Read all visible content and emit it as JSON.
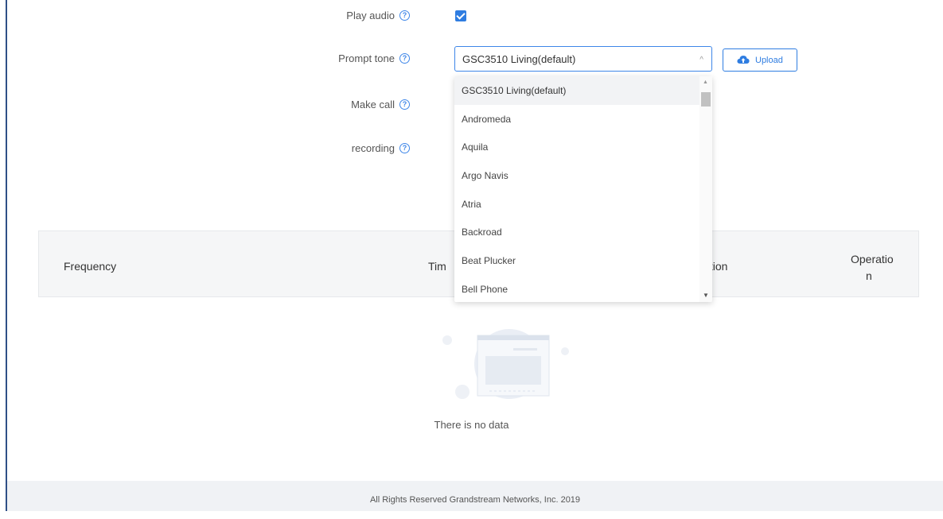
{
  "form": {
    "play_audio_label": "Play audio",
    "prompt_tone_label": "Prompt tone",
    "make_call_label": "Make call",
    "recording_label": "recording",
    "help_glyph": "?",
    "play_audio_checked": true,
    "prompt_tone_value": "GSC3510 Living(default)",
    "caret": "^",
    "upload_label": "Upload"
  },
  "dropdown": {
    "options": [
      "GSC3510 Living(default)",
      "Andromeda",
      "Aquila",
      "Argo Navis",
      "Atria",
      "Backroad",
      "Beat Plucker",
      "Bell Phone"
    ],
    "selected_index": 0,
    "scroll_up": "▲",
    "scroll_down": "▼"
  },
  "table": {
    "columns": [
      "Frequency",
      "Tim",
      "ıction",
      "Operatio",
      "n"
    ]
  },
  "empty": {
    "text": "There is no data"
  },
  "footer": {
    "text": "All Rights Reserved Grandstream Networks, Inc. 2019"
  },
  "colors": {
    "accent": "#2f7de1",
    "frame": "#2f4f86"
  }
}
